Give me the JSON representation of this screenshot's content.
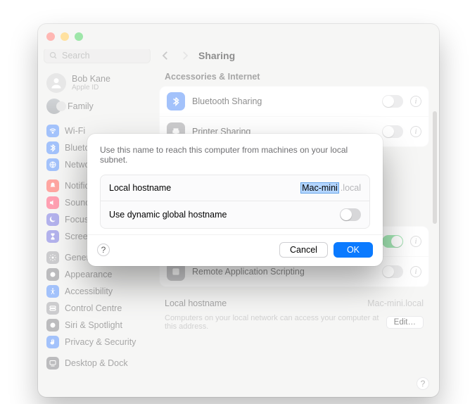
{
  "window": {
    "search_placeholder": "Search",
    "user": {
      "name": "Bob Kane",
      "sub": "Apple ID"
    },
    "family_label": "Family"
  },
  "sidebar": {
    "group1": [
      {
        "label": "Wi-Fi",
        "color": "c-blue"
      },
      {
        "label": "Bluetooth",
        "color": "c-blue"
      },
      {
        "label": "Network",
        "color": "c-blue"
      }
    ],
    "group2": [
      {
        "label": "Notifications",
        "color": "c-red"
      },
      {
        "label": "Sound",
        "color": "c-pink"
      },
      {
        "label": "Focus",
        "color": "c-purple"
      },
      {
        "label": "Screen Time",
        "color": "c-purple"
      }
    ],
    "group3": [
      {
        "label": "General",
        "color": "c-grey"
      },
      {
        "label": "Appearance",
        "color": "c-dgrey"
      },
      {
        "label": "Accessibility",
        "color": "c-blue"
      },
      {
        "label": "Control Centre",
        "color": "c-grey"
      },
      {
        "label": "Siri & Spotlight",
        "color": "c-dgrey"
      },
      {
        "label": "Privacy & Security",
        "color": "c-blue"
      }
    ],
    "group4": [
      {
        "label": "Desktop & Dock",
        "color": "c-dgrey"
      }
    ]
  },
  "header": {
    "title": "Sharing"
  },
  "section_accessories": "Accessories & Internet",
  "services": [
    {
      "label": "Bluetooth Sharing",
      "color": "c-blue",
      "on": false
    },
    {
      "label": "Printer Sharing",
      "color": "c-grey",
      "on": false
    }
  ],
  "services2": [
    {
      "label": "Remote Application Scripting",
      "color": "c-grey",
      "on": false
    }
  ],
  "services_hidden_toggle_on": true,
  "hostname": {
    "title": "Local hostname",
    "value": "Mac-mini.local",
    "desc": "Computers on your local network can access your computer at this address.",
    "edit": "Edit…"
  },
  "modal": {
    "hint": "Use this name to reach this computer from machines on your local subnet.",
    "row1_label": "Local hostname",
    "row1_value": "Mac-mini",
    "row1_suffix": ".local",
    "row2_label": "Use dynamic global hostname",
    "row2_on": false,
    "help": "?",
    "cancel": "Cancel",
    "ok": "OK"
  },
  "help_char": "?"
}
